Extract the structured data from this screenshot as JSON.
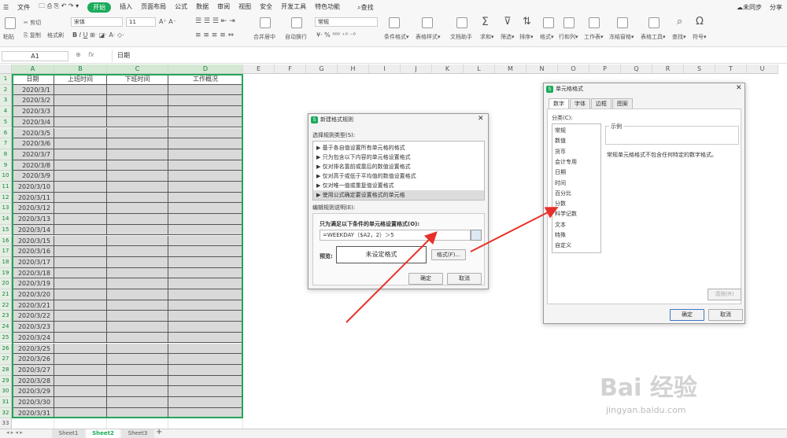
{
  "menu": {
    "file": "文件",
    "tabs": [
      "开始",
      "插入",
      "页面布局",
      "公式",
      "数据",
      "审阅",
      "视图",
      "安全",
      "开发工具",
      "特色功能"
    ],
    "search": "查找",
    "sync": "未同步",
    "share": "分享"
  },
  "toolbar": {
    "paste": "粘贴",
    "format_painter": "格式刷",
    "cut": "剪切",
    "copy": "复制",
    "font": "宋体",
    "size": "11",
    "merge": "合并居中",
    "wrap": "自动换行",
    "number_format": "常规",
    "cond_format": "条件格式",
    "table_style": "表格样式",
    "doc_helper": "文档助手",
    "sum": "求和",
    "filter": "筛选",
    "sort": "排序",
    "format": "格式",
    "rowcol": "行和列",
    "worksheet": "工作表",
    "freeze": "冻结窗格",
    "table_tools": "表格工具",
    "find": "查找",
    "symbol": "符号"
  },
  "formula_bar": {
    "name_box": "A1",
    "fx": "fx",
    "value": "日期"
  },
  "columns": [
    "A",
    "B",
    "C",
    "D",
    "E",
    "F",
    "G",
    "H",
    "I",
    "J",
    "K",
    "L",
    "M",
    "N",
    "O",
    "P",
    "Q",
    "R",
    "S",
    "T",
    "U"
  ],
  "headers": [
    "日期",
    "上班时间",
    "下班时间",
    "工作概况"
  ],
  "dates": [
    "2020/3/1",
    "2020/3/2",
    "2020/3/3",
    "2020/3/4",
    "2020/3/5",
    "2020/3/6",
    "2020/3/7",
    "2020/3/8",
    "2020/3/9",
    "2020/3/10",
    "2020/3/11",
    "2020/3/12",
    "2020/3/13",
    "2020/3/14",
    "2020/3/15",
    "2020/3/16",
    "2020/3/17",
    "2020/3/18",
    "2020/3/19",
    "2020/3/20",
    "2020/3/21",
    "2020/3/22",
    "2020/3/23",
    "2020/3/24",
    "2020/3/25",
    "2020/3/26",
    "2020/3/27",
    "2020/3/28",
    "2020/3/29",
    "2020/3/30",
    "2020/3/31"
  ],
  "row_count": 33,
  "sheets": [
    "Sheet1",
    "Sheet2",
    "Sheet3"
  ],
  "active_sheet": "Sheet2",
  "new_rule_dialog": {
    "title": "新建格式规则",
    "rule_type_label": "选择规则类型(S):",
    "rule_types": [
      "基于各自值设置所有单元格的格式",
      "只为包含以下内容的单元格设置格式",
      "仅对排名靠前或靠后的数值设置格式",
      "仅对高于或低于平均值的数值设置格式",
      "仅对唯一值或重复值设置格式",
      "使用公式确定要设置格式的单元格"
    ],
    "selected_rule": 5,
    "edit_label": "编辑规则说明(E):",
    "formula_label": "只为满足以下条件的单元格设置格式(O):",
    "formula": "=WEEKDAY（$A2，2）＞5",
    "preview_label": "预览:",
    "preview_text": "未设定格式",
    "format_button": "格式(F)...",
    "ok": "确定",
    "cancel": "取消"
  },
  "cell_format_dialog": {
    "title": "单元格格式",
    "tabs": [
      "数字",
      "字体",
      "边框",
      "图案"
    ],
    "active_tab": "数字",
    "category_label": "分类(C):",
    "categories": [
      "常规",
      "数值",
      "货币",
      "会计专用",
      "日期",
      "时间",
      "百分比",
      "分数",
      "科学记数",
      "文本",
      "特殊",
      "自定义"
    ],
    "sample_label": "示例",
    "description": "常规单元格格式不包含任何特定的数字格式。",
    "clear": "清除(R)",
    "ok": "确定",
    "cancel": "取消"
  },
  "watermark": {
    "brand": "Bai  经验",
    "url": "jingyan.baidu.com"
  },
  "colors": {
    "accent": "#1aab5a",
    "arrow": "#e8302a",
    "selection": "#23a55a",
    "range_fill": "#d9d9d9"
  }
}
